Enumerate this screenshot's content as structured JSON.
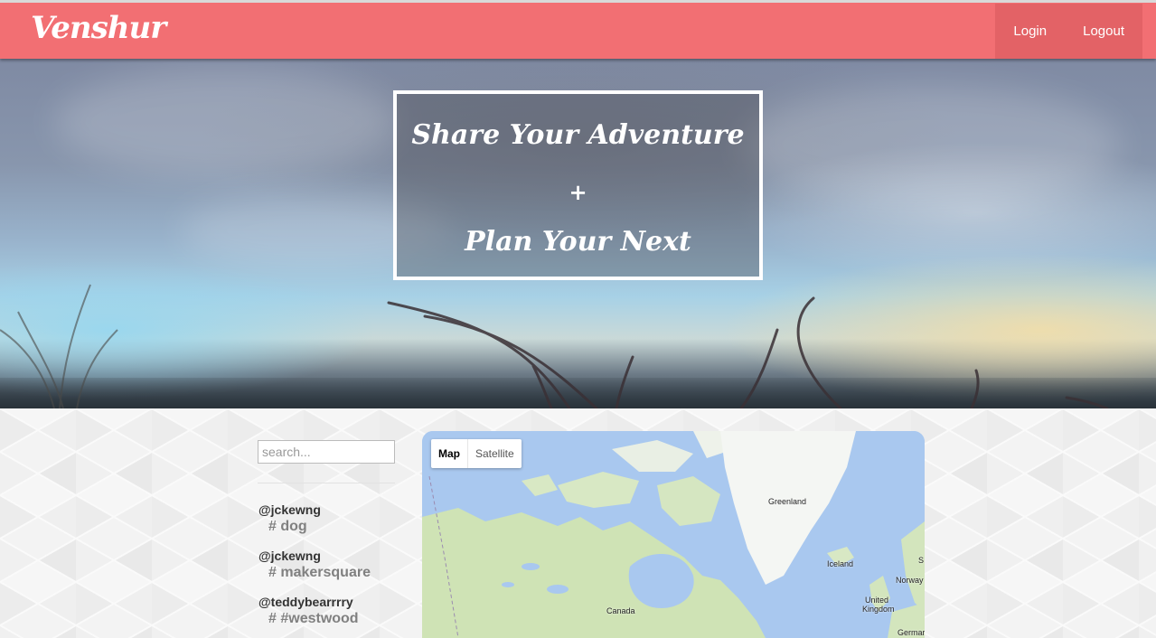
{
  "nav": {
    "brand": "Venshur",
    "login": "Login",
    "logout": "Logout"
  },
  "hero": {
    "line1": "Share Your Adventure",
    "plus": "+",
    "line2": "Plan Your Next"
  },
  "search": {
    "placeholder": "search..."
  },
  "feed": [
    {
      "user": "@jckewng",
      "tag": "# dog"
    },
    {
      "user": "@jckewng",
      "tag": "# makersquare"
    },
    {
      "user": "@teddybearrrry",
      "tag": "# #westwood"
    }
  ],
  "map": {
    "type_map": "Map",
    "type_satellite": "Satellite",
    "labels": {
      "greenland": "Greenland",
      "iceland": "Iceland",
      "norway": "Norway",
      "uk_line1": "United",
      "uk_line2": "Kingdom",
      "canada": "Canada",
      "german": "Germar",
      "s": "S"
    }
  },
  "colors": {
    "navbar": "#f26f73",
    "nav_actions": "#e36266",
    "map_water": "#a9c8ef",
    "map_land": "#cde3b4"
  }
}
